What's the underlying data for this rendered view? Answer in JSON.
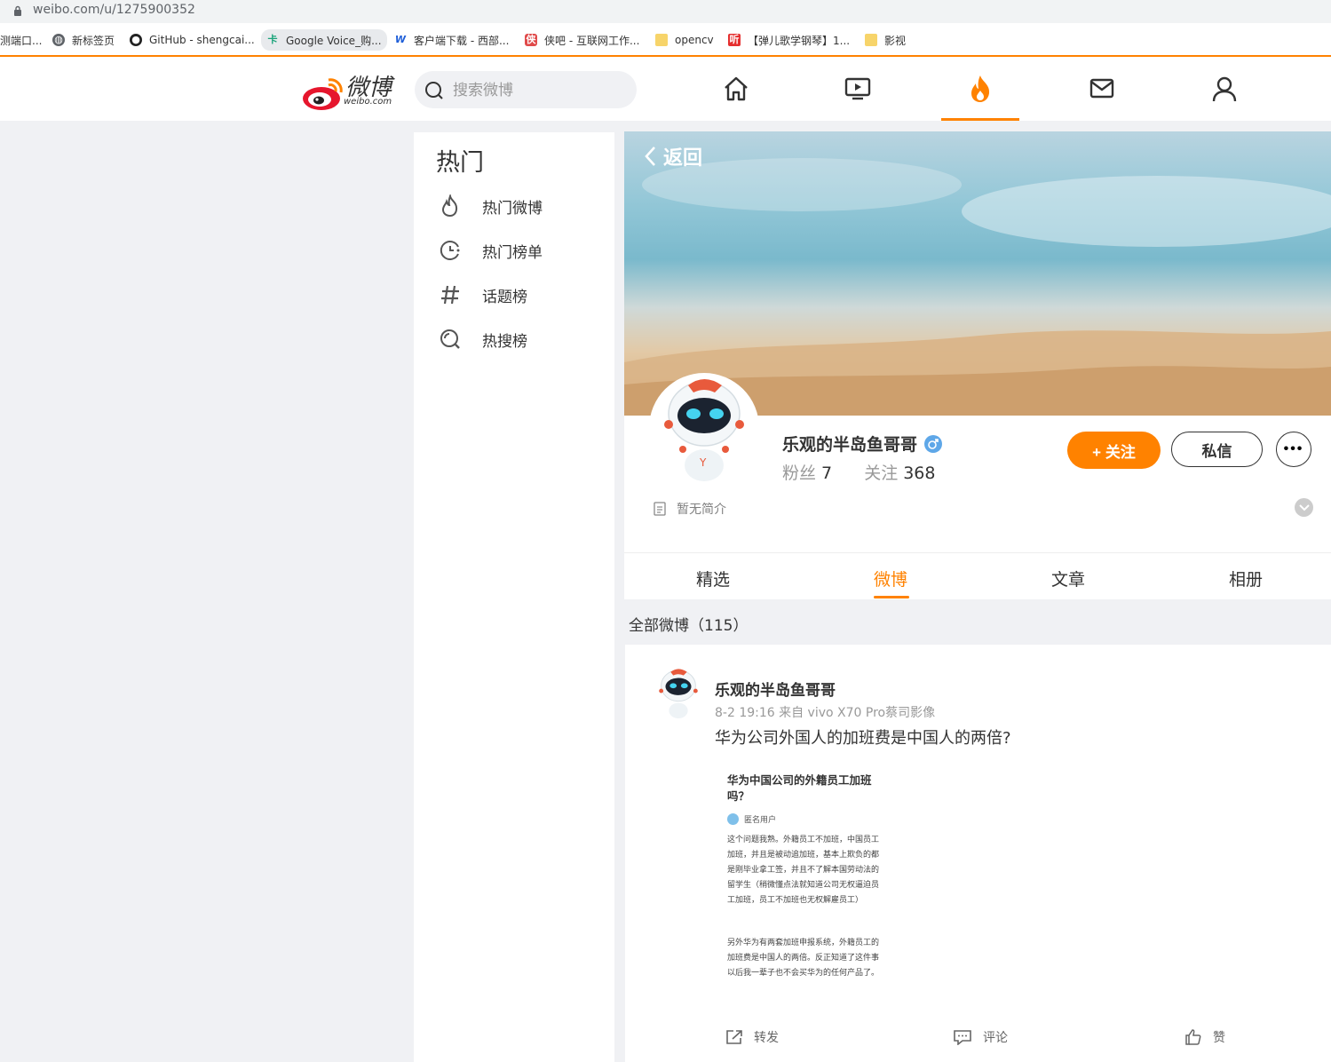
{
  "browser": {
    "url": "weibo.com/u/1275900352",
    "bookmarks": [
      {
        "label": "测端口...",
        "icon": "page-icon"
      },
      {
        "label": "新标签页",
        "icon": "globe-icon"
      },
      {
        "label": "GitHub - shengcai...",
        "icon": "github-icon"
      },
      {
        "label": "Google Voice_购...",
        "icon": "card-icon"
      },
      {
        "label": "客户端下载 - 西部...",
        "icon": "w-icon"
      },
      {
        "label": "侠吧 - 互联网工作...",
        "icon": "xiaba-icon"
      },
      {
        "label": "opencv",
        "icon": "folder-icon"
      },
      {
        "label": "【弹儿歌学钢琴】1...",
        "icon": "listen-icon"
      },
      {
        "label": "影视",
        "icon": "folder-icon"
      }
    ]
  },
  "header": {
    "logo_cn": "微博",
    "logo_en": "weibo.com",
    "search_placeholder": "搜索微博",
    "nav": [
      "home-icon",
      "video-icon",
      "hot-icon",
      "message-icon",
      "user-icon"
    ],
    "active_nav": "hot-icon",
    "accent": "#ff8200"
  },
  "sidebar": {
    "title": "热门",
    "items": [
      {
        "label": "热门微博",
        "icon": "flame-outline-icon"
      },
      {
        "label": "热门榜单",
        "icon": "clock-rank-icon"
      },
      {
        "label": "话题榜",
        "icon": "hashtag-icon"
      },
      {
        "label": "热搜榜",
        "icon": "search-rank-icon"
      }
    ]
  },
  "profile": {
    "back_label": "返回",
    "name": "乐观的半岛鱼哥哥",
    "fans_label": "粉丝",
    "fans": "7",
    "follow_label": "关注",
    "following": "368",
    "follow_button": "+ 关注",
    "message_button": "私信",
    "more_button": "•••",
    "bio": "暂无简介",
    "tabs": [
      "精选",
      "微博",
      "文章",
      "相册"
    ],
    "active_tab": "微博"
  },
  "feed": {
    "count_label": "全部微博（115）"
  },
  "post": {
    "author": "乐观的半岛鱼哥哥",
    "meta": "8-2 19:16 来自 vivo X70 Pro蔡司影像",
    "text": "华为公司外国人的加班费是中国人的两倍?",
    "image": {
      "title": "华为中国公司的外籍员工加班吗？",
      "user": "匿名用户",
      "para1": "这个问题我熟。外籍员工不加班，中国员工加班，并且是被动追加班，基本上欺负的都是刚毕业拿工签，并且不了解本国劳动法的留学生（稍微懂点法就知道公司无权逼迫员工加班，员工不加班也无权解雇员工）",
      "para2": "另外华为有两套加班申报系统，外籍员工的加班费是中国人的两倍。反正知道了这件事以后我一辈子也不会买华为的任何产品了。"
    },
    "actions": {
      "repost": "转发",
      "comment": "评论",
      "like": "赞"
    }
  }
}
